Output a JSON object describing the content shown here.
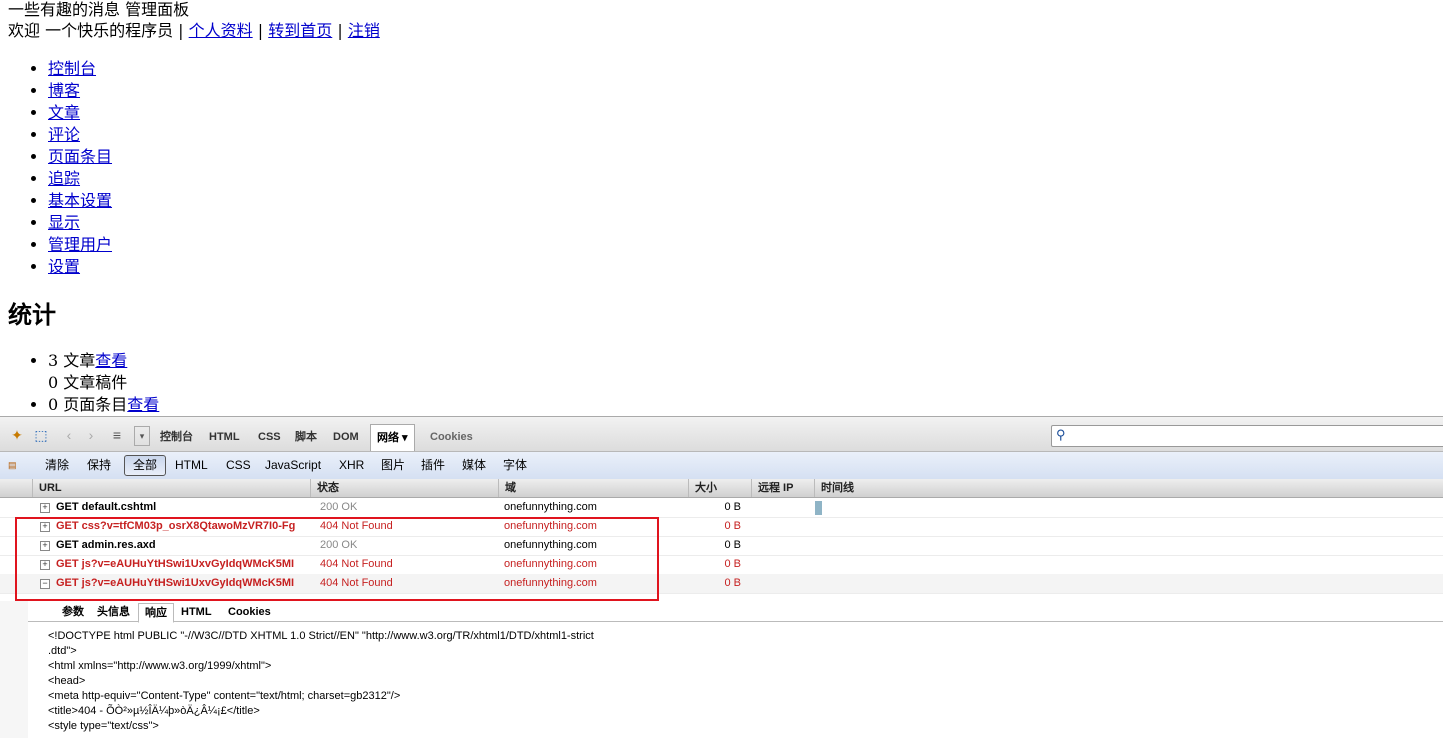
{
  "header": {
    "site_title": "一些有趣的消息 管理面板",
    "welcome": "欢迎  一个快乐的程序员 | ",
    "profile_link": "个人资料",
    "sep1": " | ",
    "home_link": "转到首页",
    "sep2": " | ",
    "logout_link": "注销"
  },
  "nav": [
    "控制台",
    "博客",
    "文章",
    "评论",
    "页面条目",
    "追踪",
    "基本设置",
    "显示",
    "管理用户",
    "设置"
  ],
  "stats": {
    "title": "统计",
    "posts": "3 文章",
    "posts_link": "查看",
    "drafts": "0 文章稿件",
    "pages": "0 页面条目",
    "pages_link": "查看"
  },
  "firebug": {
    "panels": [
      "控制台",
      "HTML",
      "CSS",
      "脚本",
      "DOM",
      "网络 ▾",
      "Cookies"
    ],
    "filters": [
      "清除",
      "保持",
      "全部",
      "HTML",
      "CSS",
      "JavaScript",
      "XHR",
      "图片",
      "插件",
      "媒体",
      "字体"
    ],
    "columns": [
      "URL",
      "状态",
      "域",
      "大小",
      "远程 IP",
      "时间线"
    ],
    "requests": [
      {
        "url": "GET default.cshtml",
        "status": "200 OK",
        "domain": "onefunnything.com",
        "size": "0 B",
        "ok": true,
        "toggle": "+"
      },
      {
        "url": "GET css?v=tfCM03p_osrX8QtawoMzVR7I0-Fg",
        "status": "404 Not Found",
        "domain": "onefunnything.com",
        "size": "0 B",
        "ok": false,
        "toggle": "+"
      },
      {
        "url": "GET admin.res.axd",
        "status": "200 OK",
        "domain": "onefunnything.com",
        "size": "0 B",
        "ok": true,
        "toggle": "+"
      },
      {
        "url": "GET js?v=eAUHuYtHSwi1UxvGyIdqWMcK5MI",
        "status": "404 Not Found",
        "domain": "onefunnything.com",
        "size": "0 B",
        "ok": false,
        "toggle": "+"
      },
      {
        "url": "GET js?v=eAUHuYtHSwi1UxvGyIdqWMcK5MI",
        "status": "404 Not Found",
        "domain": "onefunnything.com",
        "size": "0 B",
        "ok": false,
        "toggle": "−"
      }
    ],
    "detail_tabs": [
      "参数",
      "头信息",
      "响应",
      "HTML",
      "Cookies"
    ],
    "response_lines": [
      "<!DOCTYPE html PUBLIC \"-//W3C//DTD XHTML 1.0 Strict//EN\" \"http://www.w3.org/TR/xhtml1/DTD/xhtml1-strict",
      ".dtd\">",
      "<html xmlns=\"http://www.w3.org/1999/xhtml\">",
      "<head>",
      "<meta http-equiv=\"Content-Type\" content=\"text/html; charset=gb2312\"/>",
      "<title>404 - ÕÒ²»µ½ÎÄ¼þ»òÄ¿Â¼¡£</title>",
      "<style type=\"text/css\">"
    ]
  },
  "colors": {
    "error": "#c62121",
    "highlight_box": "#e0141e",
    "link": "#0000cc"
  },
  "icons": [
    "firebug-icon",
    "inspect-icon",
    "back-icon",
    "forward-icon",
    "list-icon",
    "dropdown-icon",
    "search-icon",
    "xhr-icon"
  ]
}
